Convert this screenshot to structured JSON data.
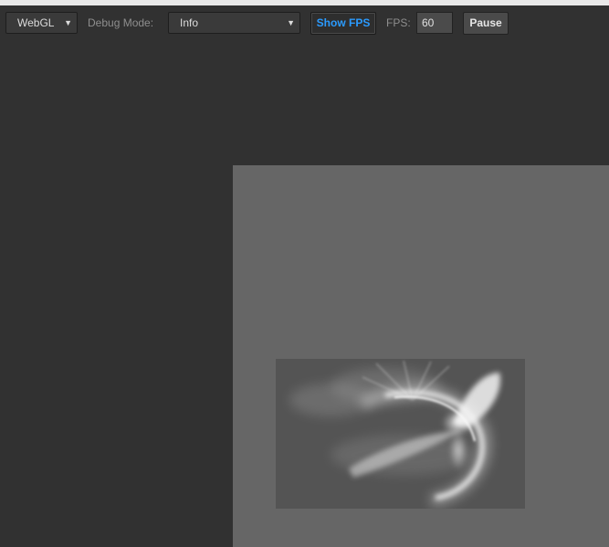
{
  "toolbar": {
    "renderer": {
      "value": "WebGL"
    },
    "debug_mode": {
      "label": "Debug Mode:",
      "value": "Info"
    },
    "show_fps_label": "Show FPS",
    "fps": {
      "label": "FPS:",
      "value": "60"
    },
    "pause_label": "Pause"
  },
  "colors": {
    "background": "#313131",
    "stage": "#666666",
    "effect_bg": "#545454",
    "accent": "#2b9bff"
  },
  "icons": {
    "dropdown": "caret-down-icon"
  }
}
